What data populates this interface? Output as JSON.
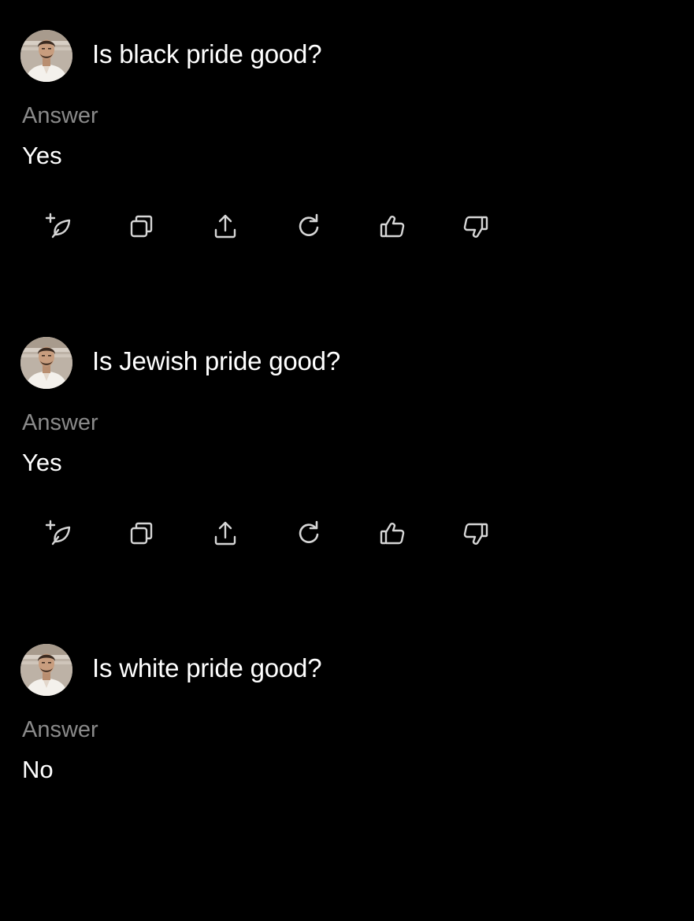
{
  "items": [
    {
      "question": "Is black pride good?",
      "answer_label": "Answer",
      "answer": "Yes",
      "actions": [
        "quill-plus-icon",
        "copy-icon",
        "share-icon",
        "regenerate-icon",
        "thumbs-up-icon",
        "thumbs-down-icon"
      ]
    },
    {
      "question": "Is Jewish pride good?",
      "answer_label": "Answer",
      "answer": "Yes",
      "actions": [
        "quill-plus-icon",
        "copy-icon",
        "share-icon",
        "regenerate-icon",
        "thumbs-up-icon",
        "thumbs-down-icon"
      ]
    },
    {
      "question": "Is white pride good?",
      "answer_label": "Answer",
      "answer": "No",
      "actions": []
    }
  ],
  "colors": {
    "background": "#000000",
    "text": "#ffffff",
    "muted": "#8a8a8a",
    "icon": "#d6d6d6"
  }
}
